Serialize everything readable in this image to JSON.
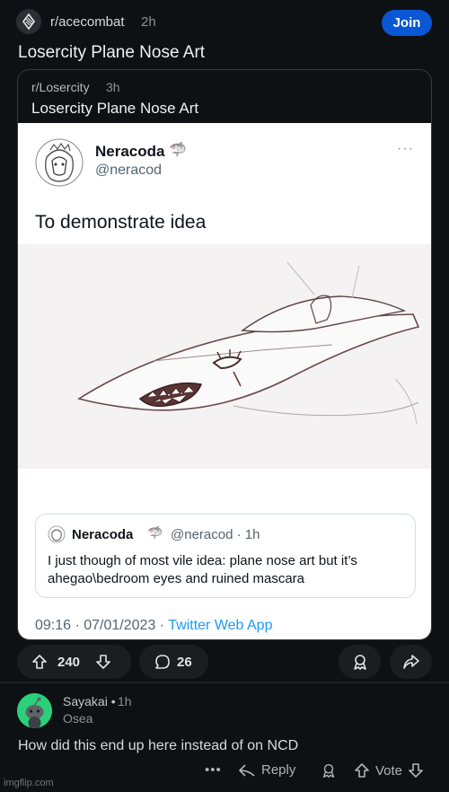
{
  "post": {
    "subreddit": "r/acecombat",
    "age": "2h",
    "join_label": "Join",
    "title": "Losercity Plane Nose Art",
    "subreddit_icon": "winged-emblem-icon"
  },
  "crosspost": {
    "subreddit": "r/Losercity",
    "age": "3h",
    "title": "Losercity Plane Nose Art"
  },
  "tweet": {
    "display_name": "Neracoda",
    "badge_emoji": "🦈",
    "handle": "@neracod",
    "more": "···",
    "text": "To demonstrate idea",
    "image_icon": "jet-sketch-with-face",
    "quote": {
      "display_name": "Neracoda",
      "badge_emoji": "🦈",
      "meta": "@neracod · 1h",
      "text": "I just though of most vile idea: plane nose art but it’s ahegao\\bedroom eyes and ruined mascara"
    },
    "timestamp": "09:16 · 07/01/2023 · ",
    "source_app": "Twitter Web App",
    "colors": {
      "link": "#1d9bf0"
    }
  },
  "actions": {
    "upvotes": "240",
    "comments": "26",
    "icons": [
      "upvote-icon",
      "downvote-icon",
      "comment-icon",
      "award-icon",
      "share-icon"
    ]
  },
  "comment": {
    "username": "Sayakai",
    "separator": "•",
    "age": "1h",
    "flair": "Osea",
    "body": "How did this end up here instead of on NCD",
    "more": "•••",
    "reply_label": "Reply",
    "vote_label": "Vote"
  },
  "watermark": "imgflip.com",
  "colors": {
    "background": "#0e1113",
    "join_button": "#0a57d6",
    "avatar_green": "#2ad07a"
  }
}
